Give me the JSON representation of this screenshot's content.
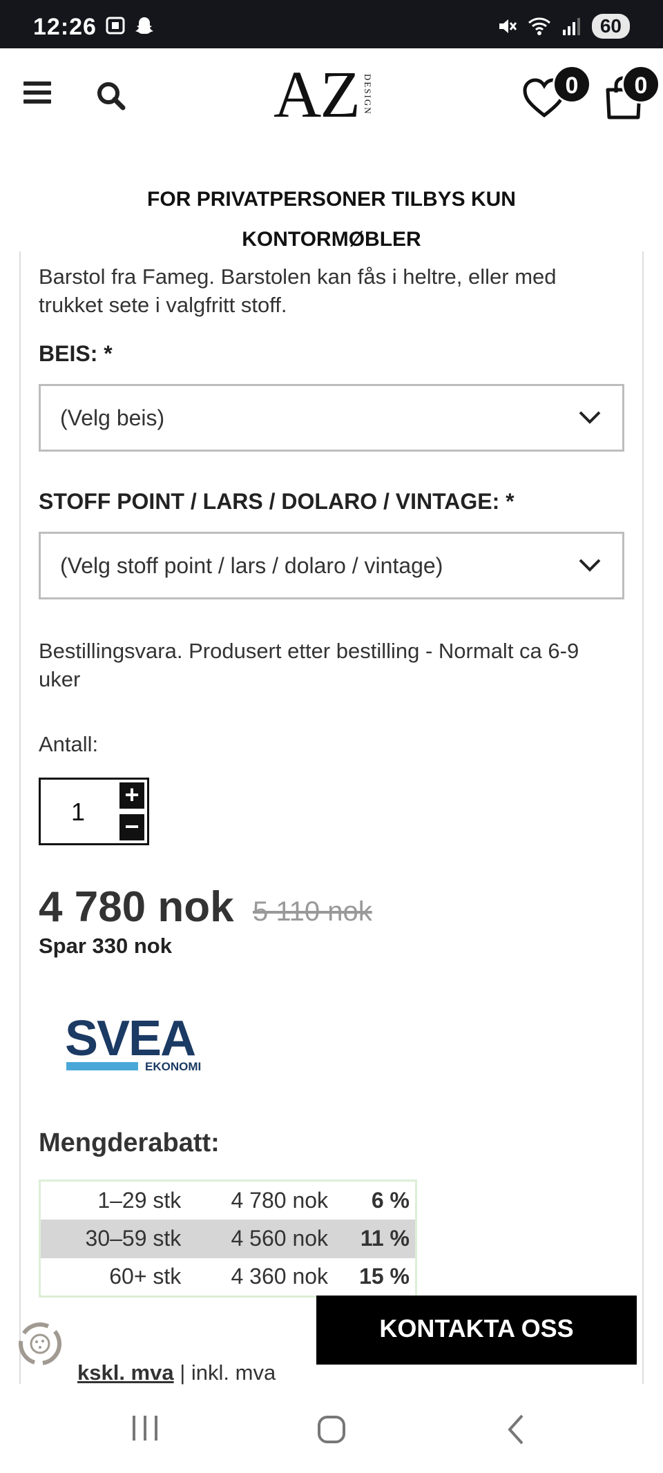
{
  "status_bar": {
    "time": "12:26",
    "battery": "60",
    "left_icons": [
      "screenshot-icon",
      "snapchat-icon"
    ],
    "right_icons": [
      "mute-icon",
      "wifi-icon",
      "signal-icon"
    ]
  },
  "header": {
    "logo_main": "AZ",
    "logo_sub": "DESIGN",
    "wishlist_count": "0",
    "cart_count": "0"
  },
  "notice": {
    "line1": "FOR PRIVATPERSONER TILBYS KUN",
    "line2": "KONTORMØBLER"
  },
  "product": {
    "description": "Barstol fra Fameg. Barstolen kan fås i heltre, eller med trukket sete i valgfritt stoff.",
    "beis_label": "BEIS: *",
    "beis_value": "(Velg beis)",
    "stoff_label": "STOFF POINT / LARS / DOLARO / VINTAGE: *",
    "stoff_value": "(Velg stoff point / lars / dolaro / vintage)",
    "delivery": "Bestillingsvara. Produsert etter bestilling - Normalt ca 6-9 uker",
    "quantity_label": "Antall:",
    "quantity_value": "1",
    "plus": "+",
    "minus": "−",
    "price": "4 780 nok",
    "old_price": "5 110 nok",
    "savings": "Spar 330 nok"
  },
  "svea": {
    "name": "SVEA",
    "sub": "EKONOMI",
    "colors": {
      "dark": "#1b3a64",
      "light": "#4aa8d8"
    }
  },
  "discounts": {
    "title": "Mengderabatt:",
    "rows": [
      {
        "qty": "1–29 stk",
        "price": "4 780 nok",
        "pct": "6 %"
      },
      {
        "qty": "30–59 stk",
        "price": "4 560 nok",
        "pct": "11 %"
      },
      {
        "qty": "60+ stk",
        "price": "4 360 nok",
        "pct": "15 %"
      }
    ]
  },
  "contact_button": "KONTAKTA OSS",
  "vat": {
    "excl": "kskl. mva",
    "separator": " | ",
    "incl": "inkl. mva"
  }
}
